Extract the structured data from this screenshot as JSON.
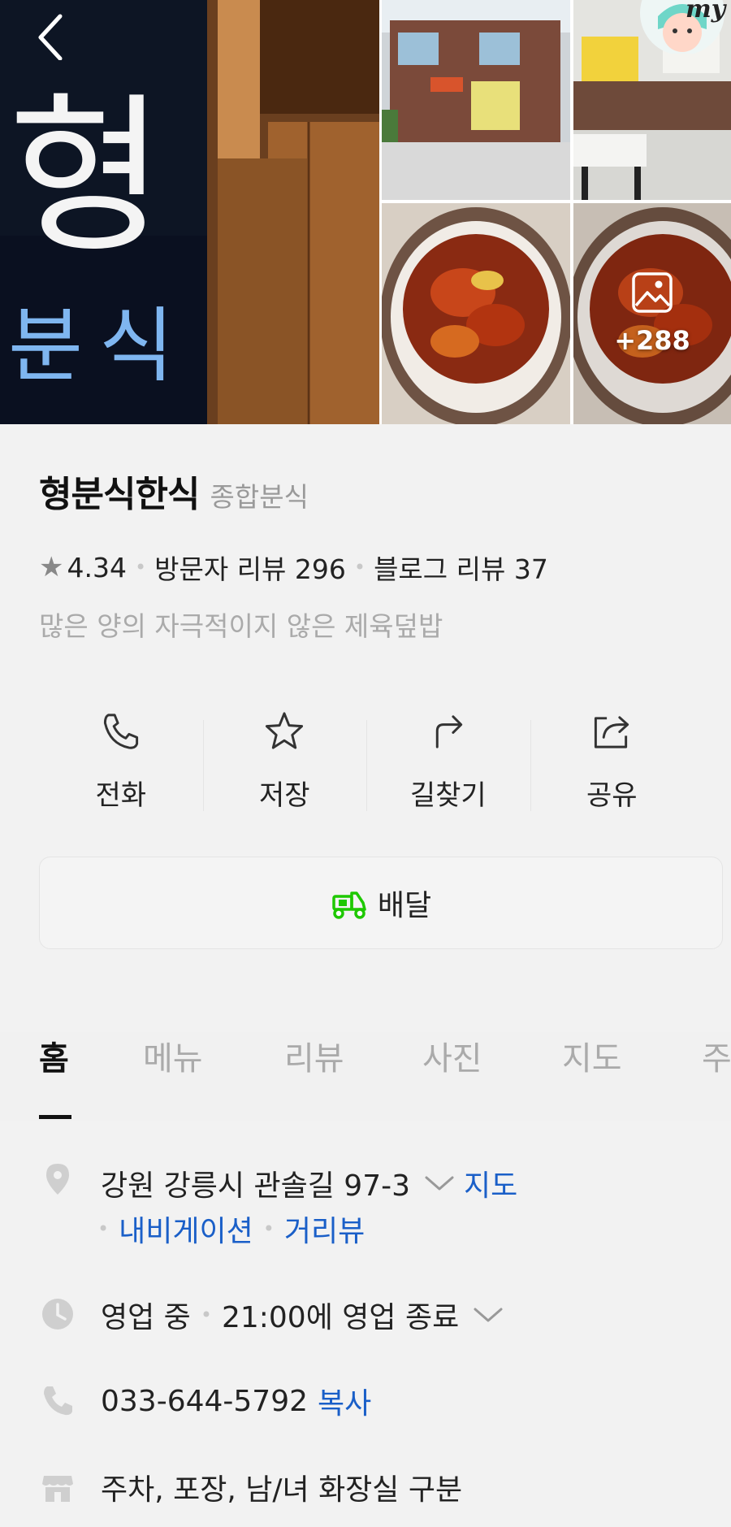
{
  "gallery": {
    "main_sign_text": "형 분식",
    "more_photos": "+288",
    "avatar_badge": "my"
  },
  "place": {
    "name": "형분식한식",
    "category": "종합분식",
    "rating": "4.34",
    "visitor_reviews": "방문자 리뷰 296",
    "blog_reviews": "블로그 리뷰 37",
    "description": "많은 양의 자극적이지 않은 제육덮밥"
  },
  "actions": {
    "call": "전화",
    "save": "저장",
    "directions": "길찾기",
    "share": "공유",
    "delivery": "배달"
  },
  "tabs": [
    "홈",
    "메뉴",
    "리뷰",
    "사진",
    "지도",
    "주"
  ],
  "details": {
    "address": "강원 강릉시 관솔길 97-3",
    "map_link": "지도",
    "navigation_link": "내비게이션",
    "streetview_link": "거리뷰",
    "status": "영업 중",
    "hours": "21:00에 영업 종료",
    "phone": "033-644-5792",
    "copy_link": "복사",
    "facilities": "주차, 포장, 남/녀 화장실 구분"
  },
  "colors": {
    "link_blue": "#1a5fc8",
    "delivery_green": "#1ec800"
  }
}
